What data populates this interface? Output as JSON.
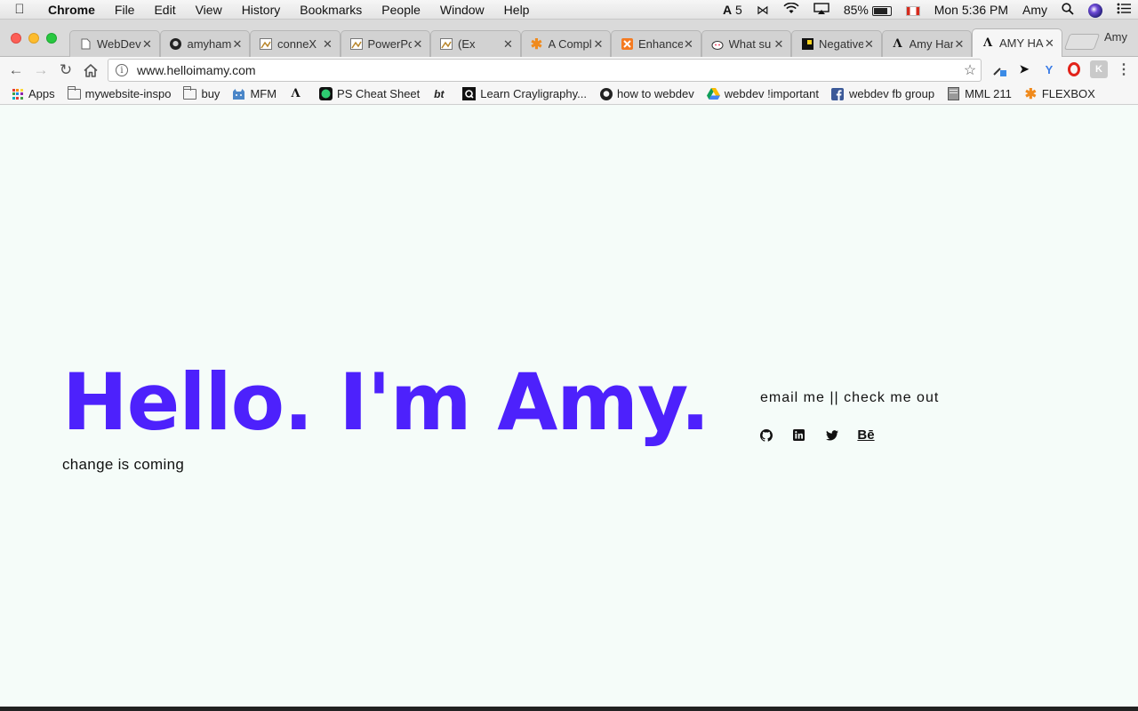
{
  "menubar": {
    "app_name": "Chrome",
    "menus": [
      "File",
      "Edit",
      "View",
      "History",
      "Bookmarks",
      "People",
      "Window",
      "Help"
    ],
    "adobe_count": "5",
    "battery": "85%",
    "clock": "Mon 5:36 PM",
    "user": "Amy"
  },
  "tabs": [
    {
      "title": "WebDev",
      "icon": "page-icon"
    },
    {
      "title": "amyham",
      "icon": "github-icon"
    },
    {
      "title": "conneX",
      "icon": "image-icon"
    },
    {
      "title": "PowerPo",
      "icon": "image-icon"
    },
    {
      "title": "(Ex",
      "icon": "image-icon"
    },
    {
      "title": "A Compl",
      "icon": "asterisk-icon"
    },
    {
      "title": "Enhance",
      "icon": "xampp-icon"
    },
    {
      "title": "What su",
      "icon": "reddit-icon"
    },
    {
      "title": "Negative",
      "icon": "square-icon"
    },
    {
      "title": "Amy Har",
      "icon": "a-logo-icon"
    },
    {
      "title": "AMY HA",
      "icon": "a-logo-icon",
      "active": true
    }
  ],
  "profile_label": "Amy",
  "address_bar": {
    "url": "www.helloimamy.com"
  },
  "bookmarks": [
    {
      "label": "Apps",
      "icon": "apps-grid-icon"
    },
    {
      "label": "mywebsite-inspo",
      "icon": "folder-icon"
    },
    {
      "label": "buy",
      "icon": "folder-icon"
    },
    {
      "label": "MFM",
      "icon": "cat-icon"
    },
    {
      "label": "",
      "icon": "a-logo-icon"
    },
    {
      "label": "PS Cheat Sheet",
      "icon": "green-circle-icon"
    },
    {
      "label": "",
      "icon": "bt-logo-icon"
    },
    {
      "label": "Learn Crayligraphy...",
      "icon": "q-logo-icon"
    },
    {
      "label": "how to webdev",
      "icon": "github-icon"
    },
    {
      "label": "webdev !important",
      "icon": "drive-icon"
    },
    {
      "label": "webdev fb group",
      "icon": "facebook-icon"
    },
    {
      "label": "MML 211",
      "icon": "doc-icon"
    },
    {
      "label": "FLEXBOX",
      "icon": "asterisk-icon"
    }
  ],
  "page": {
    "title": "Hello. I'm Amy.",
    "subtitle": "change is coming",
    "contact": {
      "email_label": "email me",
      "separator": "||",
      "checkout_label": "check me out"
    },
    "socials": [
      "github-icon",
      "linkedin-icon",
      "twitter-icon",
      "behance-icon"
    ],
    "behance_text": "Bē",
    "accent_color": "#4d21fc",
    "background_color": "#f5fcf9"
  }
}
